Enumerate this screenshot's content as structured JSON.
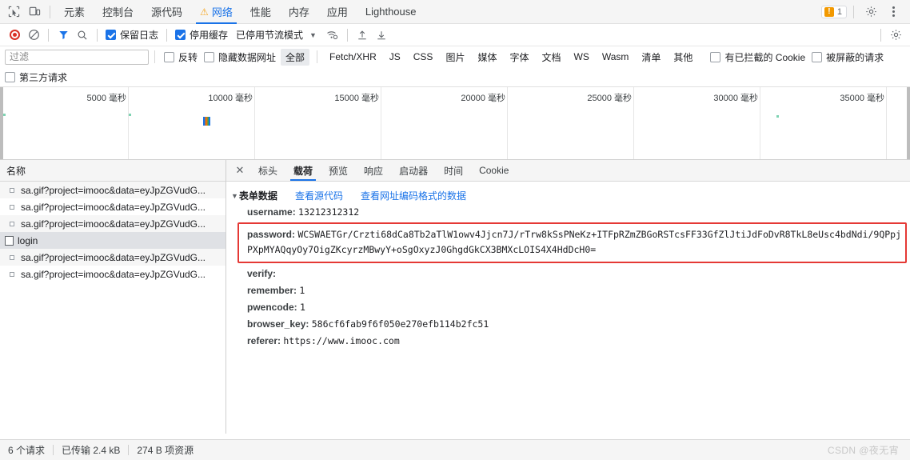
{
  "window": {
    "panel_tabs": [
      {
        "label": "元素",
        "active": false,
        "warning": false
      },
      {
        "label": "控制台",
        "active": false,
        "warning": false
      },
      {
        "label": "源代码",
        "active": false,
        "warning": false
      },
      {
        "label": "网络",
        "active": true,
        "warning": true
      },
      {
        "label": "性能",
        "active": false,
        "warning": false
      },
      {
        "label": "内存",
        "active": false,
        "warning": false
      },
      {
        "label": "应用",
        "active": false,
        "warning": false
      },
      {
        "label": "Lighthouse",
        "active": false,
        "warning": false
      }
    ],
    "issue_count": "1",
    "accent_color": "#1a73e8",
    "warning_color": "#f29900"
  },
  "toolbar": {
    "record_title": "record-button",
    "clear_title": "clear-button",
    "preserve_log": {
      "label": "保留日志",
      "checked": true
    },
    "disable_cache": {
      "label": "停用缓存",
      "checked": true
    },
    "throttle": "已停用节流模式"
  },
  "filter": {
    "placeholder": "过滤",
    "value": "",
    "invert": {
      "label": "反转",
      "checked": false
    },
    "hide_data_urls": {
      "label": "隐藏数据网址",
      "checked": false
    },
    "types": [
      {
        "label": "全部",
        "selected": true
      },
      {
        "label": "Fetch/XHR",
        "selected": false
      },
      {
        "label": "JS",
        "selected": false
      },
      {
        "label": "CSS",
        "selected": false
      },
      {
        "label": "图片",
        "selected": false
      },
      {
        "label": "媒体",
        "selected": false
      },
      {
        "label": "字体",
        "selected": false
      },
      {
        "label": "文档",
        "selected": false
      },
      {
        "label": "WS",
        "selected": false
      },
      {
        "label": "Wasm",
        "selected": false
      },
      {
        "label": "清单",
        "selected": false
      },
      {
        "label": "其他",
        "selected": false
      }
    ],
    "blocked_cookies": {
      "label": "有已拦截的 Cookie",
      "checked": false
    },
    "blocked_requests": {
      "label": "被屏蔽的请求",
      "checked": false
    },
    "third_party": {
      "label": "第三方请求",
      "checked": false
    }
  },
  "overview": {
    "ticks": [
      "5000 毫秒",
      "10000 毫秒",
      "15000 毫秒",
      "20000 毫秒",
      "25000 毫秒",
      "30000 毫秒",
      "35000 毫秒"
    ]
  },
  "request_list": {
    "column_header": "名称",
    "rows": [
      {
        "name": "sa.gif?project=imooc&data=eyJpZGVudG...",
        "icon": "gif-icon",
        "selected": false
      },
      {
        "name": "sa.gif?project=imooc&data=eyJpZGVudG...",
        "icon": "gif-icon",
        "selected": false
      },
      {
        "name": "sa.gif?project=imooc&data=eyJpZGVudG...",
        "icon": "gif-icon",
        "selected": false
      },
      {
        "name": "login",
        "icon": "document-icon",
        "selected": true
      },
      {
        "name": "sa.gif?project=imooc&data=eyJpZGVudG...",
        "icon": "gif-icon",
        "selected": false
      },
      {
        "name": "sa.gif?project=imooc&data=eyJpZGVudG...",
        "icon": "gif-icon",
        "selected": false
      }
    ]
  },
  "detail": {
    "tabs": [
      {
        "label": "标头",
        "active": false
      },
      {
        "label": "载荷",
        "active": true
      },
      {
        "label": "预览",
        "active": false
      },
      {
        "label": "响应",
        "active": false
      },
      {
        "label": "启动器",
        "active": false
      },
      {
        "label": "时间",
        "active": false
      },
      {
        "label": "Cookie",
        "active": false
      }
    ],
    "section_title": "表单数据",
    "view_source_label": "查看源代码",
    "view_urlencoded_label": "查看网址编码格式的数据",
    "fields": [
      {
        "key": "username:",
        "value": "13212312312",
        "highlight": false
      },
      {
        "key": "password:",
        "value": "WCSWAETGr/Crzti68dCa8Tb2aTlW1owv4Jjcn7J/rTrw8kSsPNeKz+ITFpRZmZBGoRSTcsFF33GfZlJtiJdFoDvR8TkL8eUsc4bdNdi/9QPpjPXpMYAQqyOy7OigZKcyrzMBwyY+oSgOxyzJ0GhgdGkCX3BMXcLOIS4X4HdDcH0=",
        "highlight": true
      },
      {
        "key": "verify:",
        "value": "",
        "highlight": false
      },
      {
        "key": "remember:",
        "value": "1",
        "highlight": false
      },
      {
        "key": "pwencode:",
        "value": "1",
        "highlight": false
      },
      {
        "key": "browser_key:",
        "value": "586cf6fab9f6f050e270efb114b2fc51",
        "highlight": false
      },
      {
        "key": "referer:",
        "value": "https://www.imooc.com",
        "highlight": false
      }
    ],
    "highlight_color": "#e53935"
  },
  "status_bar": {
    "requests": "6 个请求",
    "transferred": "已传输 2.4 kB",
    "resources": "274 B 项资源"
  },
  "watermark": "CSDN @夜无宵"
}
